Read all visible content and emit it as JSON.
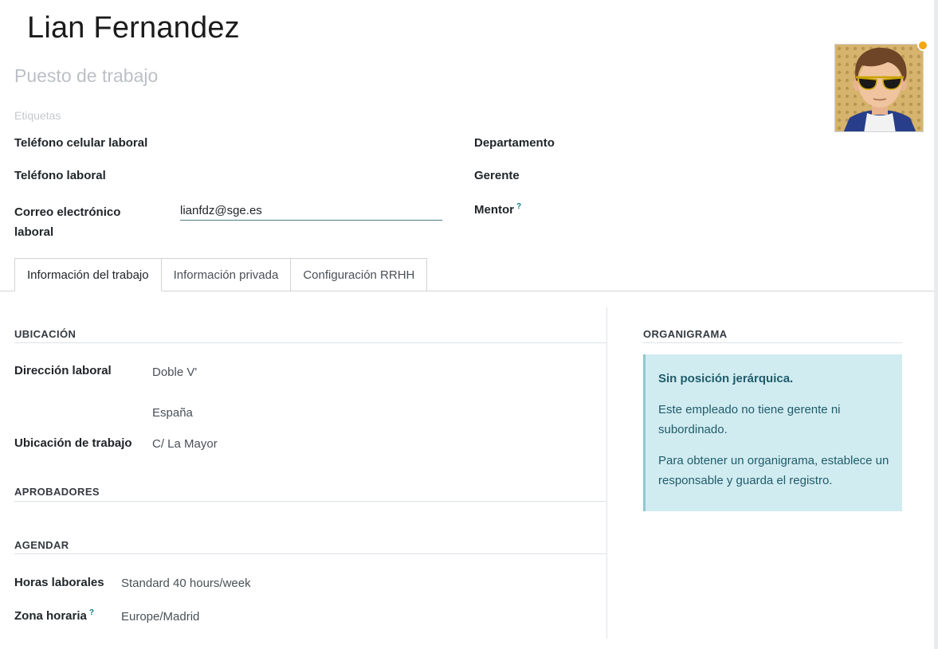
{
  "header": {
    "employee_name": "Lian Fernandez",
    "job_position_placeholder": "Puesto de trabajo",
    "tags_placeholder": "Etiquetas"
  },
  "avatar": {
    "status_color": "#f3a712"
  },
  "fields_left": {
    "mobile_label": "Teléfono celular laboral",
    "phone_label": "Teléfono laboral",
    "email_label_line1": "Correo electrónico",
    "email_label_line2": "laboral",
    "email_value": "lianfdz@sge.es"
  },
  "fields_right": {
    "department_label": "Departamento",
    "manager_label": "Gerente",
    "coach_label": "Mentor",
    "help_mark": "?"
  },
  "tabs": [
    {
      "label": "Información del trabajo",
      "active": true
    },
    {
      "label": "Información privada",
      "active": false
    },
    {
      "label": "Configuración RRHH",
      "active": false
    }
  ],
  "location_section": {
    "title": "UBICACIÓN",
    "work_address_label": "Dirección laboral",
    "work_address_line1": "Doble V'",
    "work_address_line2": "España",
    "work_location_label": "Ubicación de trabajo",
    "work_location_value": "C/ La Mayor"
  },
  "approvers_section": {
    "title": "APROBADORES"
  },
  "schedule_section": {
    "title": "AGENDAR",
    "working_hours_label": "Horas laborales",
    "working_hours_value": "Standard 40 hours/week",
    "timezone_label": "Zona horaria",
    "timezone_value": "Europe/Madrid"
  },
  "org_chart": {
    "title": "ORGANIGRAMA",
    "alert_title": "Sin posición jerárquica.",
    "alert_text1": "Este empleado no tiene gerente ni subordinado.",
    "alert_text2": "Para obtener un organigrama, establece un responsable y guarda el registro."
  },
  "colors": {
    "accent": "#017e84",
    "alert_bg": "#d1ecf1",
    "alert_text": "#1f5c6a"
  }
}
